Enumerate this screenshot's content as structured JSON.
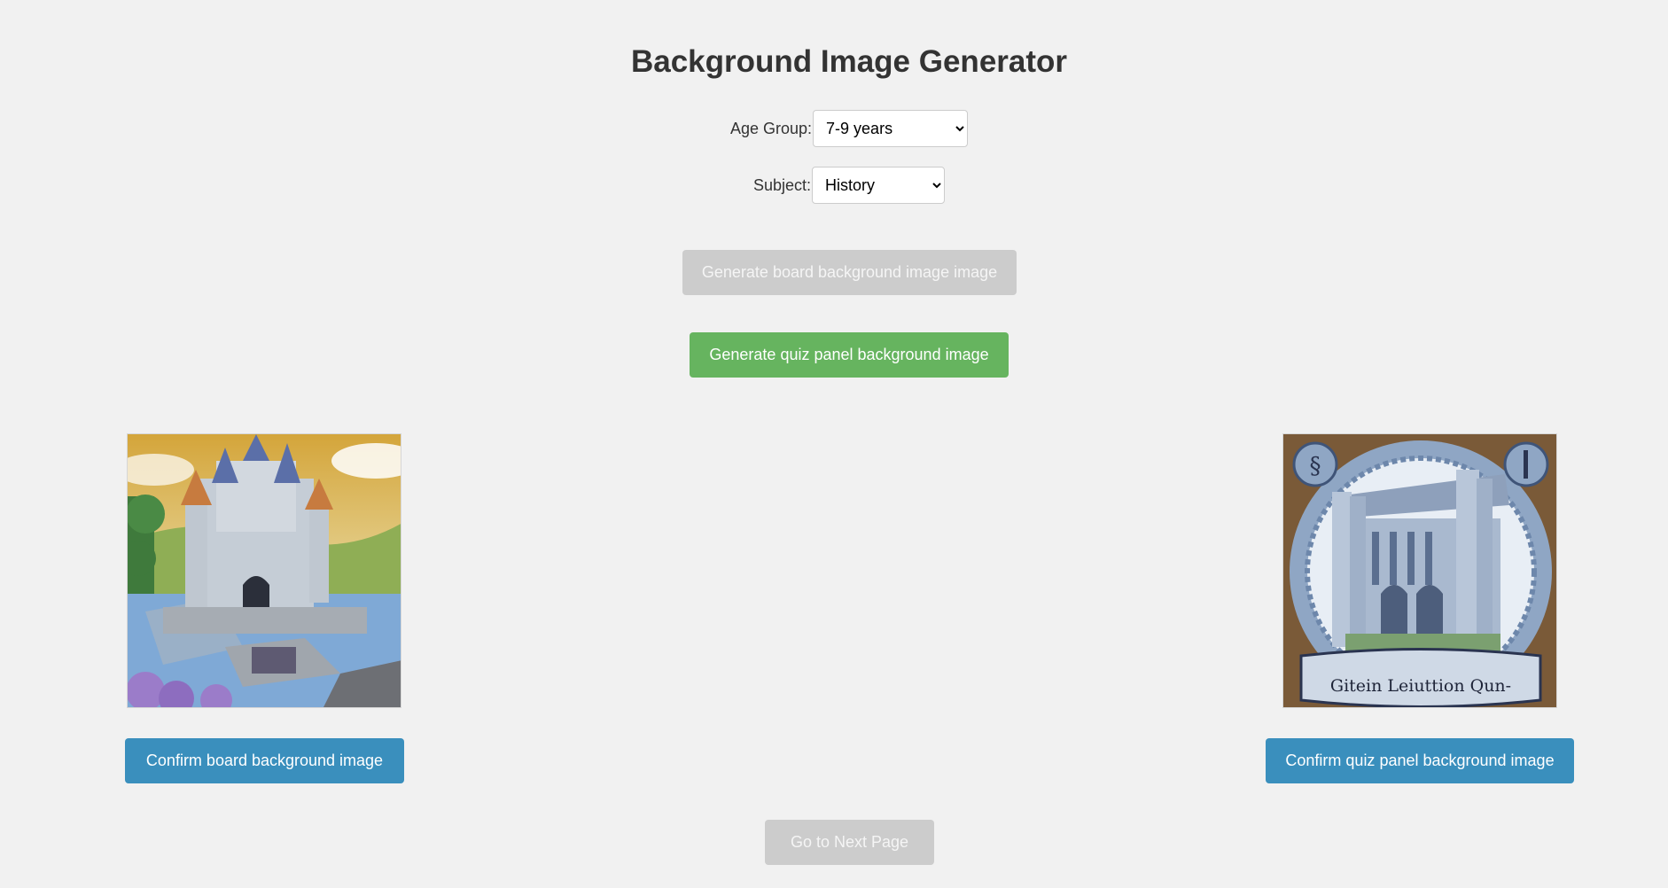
{
  "page": {
    "title": "Background Image Generator"
  },
  "form": {
    "age_group": {
      "label": "Age Group:",
      "selected": "7-9 years"
    },
    "subject": {
      "label": "Subject:",
      "selected": "History"
    }
  },
  "buttons": {
    "generate_board": "Generate board background image image",
    "generate_quiz": "Generate quiz panel background image",
    "confirm_board": "Confirm board background image",
    "confirm_quiz": "Confirm quiz panel background image",
    "next_page": "Go to Next Page"
  },
  "images": {
    "board_image_icon": "castle-illustration",
    "quiz_image_icon": "greek-temple-illustration",
    "quiz_banner_text": "Gitein Leiuttion Qun-"
  },
  "colors": {
    "background": "#f1f1f1",
    "green_button": "#66b45f",
    "blue_button": "#3a8fbd",
    "disabled_button": "#cccccc"
  }
}
